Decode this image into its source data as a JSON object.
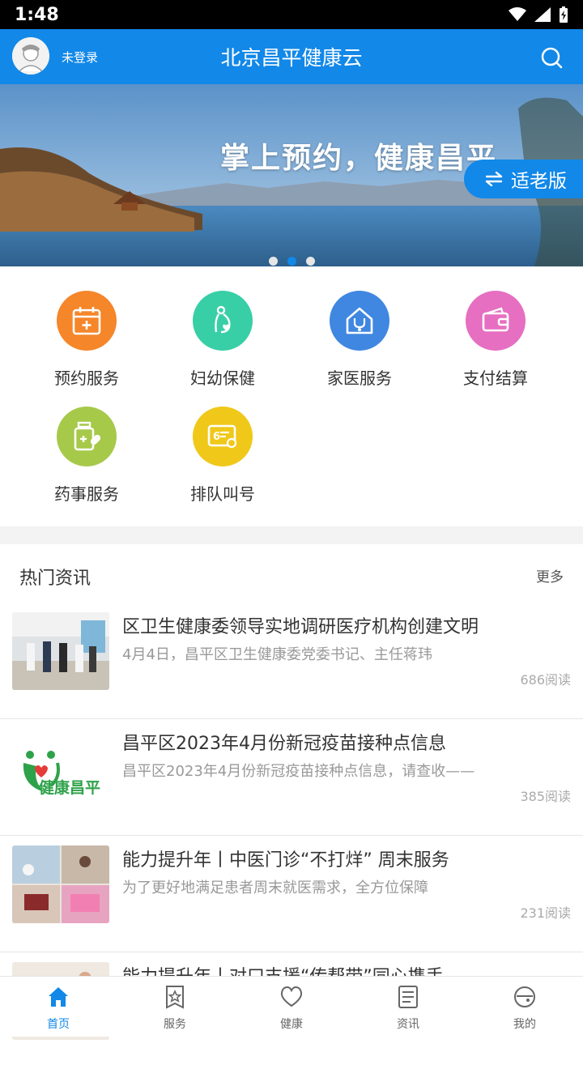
{
  "status_bar": {
    "time": "1:48"
  },
  "header": {
    "login_text": "未登录",
    "title": "北京昌平健康云"
  },
  "banner": {
    "slogan": "掌上预约，健康昌平",
    "elder_mode_label": "适老版",
    "active_dot": 1,
    "dot_count": 3
  },
  "services": [
    {
      "label": "预约服务",
      "color": "#f5862a",
      "icon": "calendar-plus-icon"
    },
    {
      "label": "妇幼保健",
      "color": "#38cfa6",
      "icon": "mother-child-icon"
    },
    {
      "label": "家医服务",
      "color": "#3f87e0",
      "icon": "home-stethoscope-icon"
    },
    {
      "label": "支付结算",
      "color": "#e66fc1",
      "icon": "wallet-icon"
    },
    {
      "label": "药事服务",
      "color": "#a6c94a",
      "icon": "medicine-bottle-icon"
    },
    {
      "label": "排队叫号",
      "color": "#f0c819",
      "icon": "queue-ticket-icon"
    }
  ],
  "news_section": {
    "title": "热门资讯",
    "more_label": "更多"
  },
  "news": [
    {
      "title": "区卫生健康委领导实地调研医疗机构创建文明",
      "desc": "4月4日，昌平区卫生健康委党委书记、主任蒋玮",
      "reads": "686阅读"
    },
    {
      "title": "昌平区2023年4月份新冠疫苗接种点信息",
      "desc": "昌平区2023年4月份新冠疫苗接种点信息，请查收——",
      "reads": "385阅读",
      "thumb_text": "健康昌平"
    },
    {
      "title": "能力提升年丨中医门诊“不打烊” 周末服务",
      "desc": "为了更好地满足患者周末就医需求，全方位保障",
      "reads": "231阅读"
    },
    {
      "title": "能力提升年丨对口支援“传帮带”同心携手",
      "desc": "",
      "reads": ""
    }
  ],
  "tabbar": [
    {
      "label": "首页",
      "icon": "home-icon",
      "active": true
    },
    {
      "label": "服务",
      "icon": "service-star-icon",
      "active": false
    },
    {
      "label": "健康",
      "icon": "heart-icon",
      "active": false
    },
    {
      "label": "资讯",
      "icon": "news-doc-icon",
      "active": false
    },
    {
      "label": "我的",
      "icon": "profile-icon",
      "active": false
    }
  ],
  "colors": {
    "primary": "#1288e8"
  }
}
